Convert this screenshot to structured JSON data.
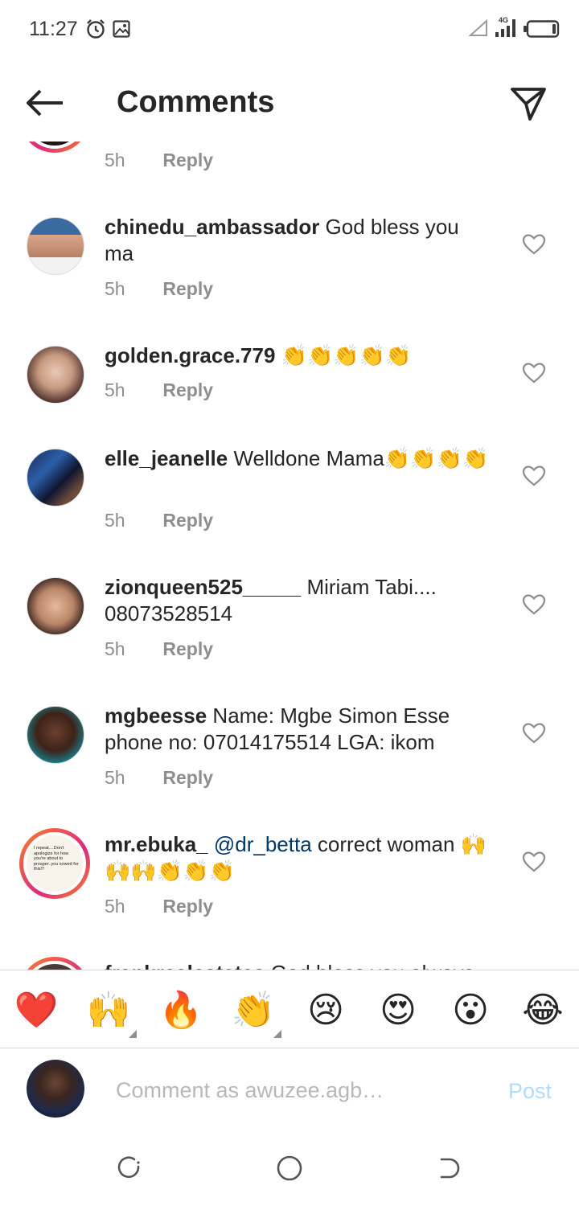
{
  "status_bar": {
    "time": "11:27",
    "network": "4G"
  },
  "header": {
    "title": "Comments"
  },
  "partial_top_comment": {
    "time": "5h",
    "reply_label": "Reply"
  },
  "comments": [
    {
      "username": "chinedu_ambassador",
      "text": " God bless you ma",
      "time": "5h",
      "reply_label": "Reply"
    },
    {
      "username": "golden.grace.779",
      "text": " 👏👏👏👏👏",
      "time": "5h",
      "reply_label": "Reply"
    },
    {
      "username": "elle_jeanelle",
      "text": " Welldone Mama👏👏👏👏",
      "time": "5h",
      "reply_label": "Reply"
    },
    {
      "username": "zionqueen525_____",
      "text": " Miriam Tabi.... 08073528514",
      "time": "5h",
      "reply_label": "Reply"
    },
    {
      "username": "mgbeesse",
      "text": " Name: Mgbe Simon Esse phone no: 07014175514  LGA: ikom",
      "time": "5h",
      "reply_label": "Reply"
    },
    {
      "username": "mr.ebuka_",
      "mention": "@dr_betta",
      "text": " correct woman 🙌🙌🙌👏👏👏",
      "time": "5h",
      "reply_label": "Reply",
      "avatar_text": "I repeat....Don't apologize for how you're about to prosper..you sowed for this!!!"
    }
  ],
  "partial_bottom_comment": {
    "username": "frankrealestates",
    "text": " God bless you always"
  },
  "emoji_bar": [
    "❤️",
    "🙌",
    "🔥",
    "👏",
    "😢",
    "😍",
    "😮",
    "😂"
  ],
  "composer": {
    "placeholder": "Comment as awuzee.agb…",
    "post_label": "Post"
  },
  "colors": {
    "link": "#00376b",
    "muted": "#8e8e8e",
    "post_disabled": "#b3dbff",
    "story_ring": "#dd2a7b"
  }
}
